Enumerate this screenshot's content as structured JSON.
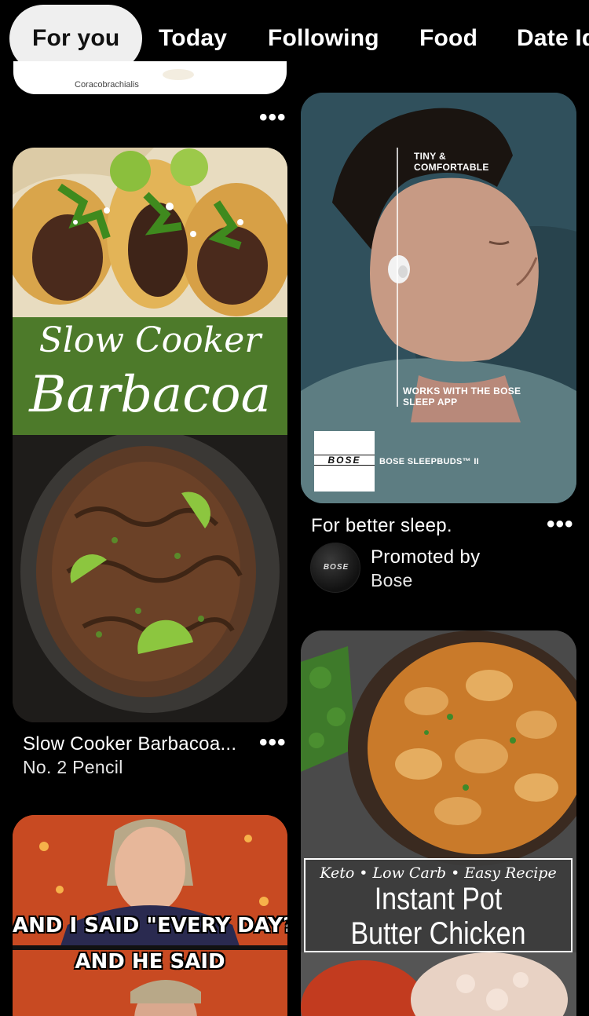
{
  "tabs": [
    {
      "label": "For you",
      "active": true
    },
    {
      "label": "Today",
      "active": false
    },
    {
      "label": "Following",
      "active": false
    },
    {
      "label": "Food",
      "active": false
    },
    {
      "label": "Date Ideas",
      "active": false
    }
  ],
  "top_pin": {
    "caption": "Coracobrachialis",
    "more_icon": "ellipsis-icon"
  },
  "barbacoa_pin": {
    "image_title_line1": "Slow Cooker",
    "image_title_line2": "Barbacoa",
    "title": "Slow Cooker Barbacoa...",
    "source": "No. 2 Pencil",
    "more_icon": "ellipsis-icon"
  },
  "bose_pin": {
    "overlay_top": "TINY & COMFORTABLE",
    "overlay_mid": "WORKS WITH THE BOSE SLEEP APP",
    "brand_logo": "BOSE",
    "product": "BOSE SLEEPBUDS™ II",
    "title": "For better sleep.",
    "promoted_label": "Promoted by",
    "promoter": "Bose",
    "avatar_text": "BOSE",
    "more_icon": "ellipsis-icon"
  },
  "meme_pin": {
    "line1": "AND I SAID \"EVERY DAY?\"",
    "line2": "AND HE SAID"
  },
  "butter_pin": {
    "tagline": "Keto • Low Carb • Easy Recipe",
    "line1": "Instant Pot",
    "line2": "Butter Chicken"
  },
  "colors": {
    "background": "#000000",
    "active_tab_bg": "#efefef",
    "barbacoa_green": "#4d7a2a"
  }
}
